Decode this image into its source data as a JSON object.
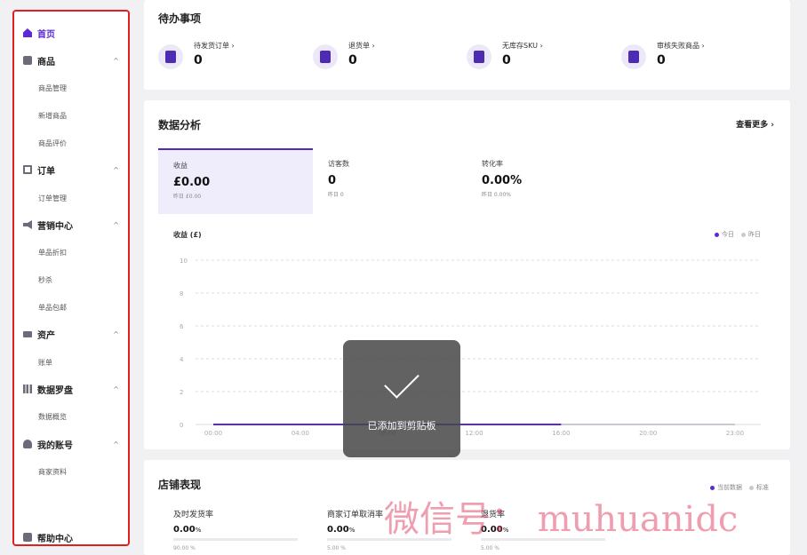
{
  "sidebar": {
    "items": [
      {
        "label": "首页",
        "icon": "home-icon",
        "active": true
      },
      {
        "label": "商品",
        "icon": "box-icon",
        "chevron": "^"
      },
      {
        "label": "商品管理"
      },
      {
        "label": "新增商品"
      },
      {
        "label": "商品评价"
      },
      {
        "label": "订单",
        "icon": "document-icon",
        "chevron": "^"
      },
      {
        "label": "订单管理"
      },
      {
        "label": "营销中心",
        "icon": "megaphone-icon",
        "chevron": "^"
      },
      {
        "label": "单品折扣"
      },
      {
        "label": "秒杀"
      },
      {
        "label": "单品包邮"
      },
      {
        "label": "资产",
        "icon": "card-icon",
        "chevron": "^"
      },
      {
        "label": "账单"
      },
      {
        "label": "数据罗盘",
        "icon": "bar-chart-icon",
        "chevron": "^"
      },
      {
        "label": "数据概览"
      },
      {
        "label": "我的账号",
        "icon": "user-icon",
        "chevron": "^"
      },
      {
        "label": "商家资料"
      },
      {
        "label": "帮助中心",
        "icon": "help-icon"
      }
    ]
  },
  "todo": {
    "title": "待办事项",
    "items": [
      {
        "label": "待发货订单 ›",
        "value": "0",
        "icon": "shipping-doc-icon"
      },
      {
        "label": "退货单 ›",
        "value": "0",
        "icon": "return-doc-icon"
      },
      {
        "label": "无库存SKU ›",
        "value": "0",
        "icon": "stock-icon"
      },
      {
        "label": "审核失败商品 ›",
        "value": "0",
        "icon": "rejected-shield-icon"
      }
    ]
  },
  "analytics": {
    "title": "数据分析",
    "more": "查看更多 ›",
    "metrics": [
      {
        "label": "收益",
        "value": "£0.00",
        "sub": "昨日 £0.00"
      },
      {
        "label": "访客数",
        "value": "0",
        "sub": "昨日 0"
      },
      {
        "label": "转化率",
        "value": "0.00%",
        "sub": "昨日 0.00%"
      }
    ],
    "chart_title": "收益 (£)",
    "legend_today": "今日",
    "legend_yesterday": "昨日"
  },
  "chart_data": {
    "type": "line",
    "x": [
      "00:00",
      "04:00",
      "08:00",
      "12:00",
      "16:00",
      "20:00",
      "23:00"
    ],
    "y_ticks": [
      "10",
      "8",
      "6",
      "4",
      "2",
      "0"
    ],
    "ylim": [
      0,
      10
    ],
    "series": [
      {
        "name": "今日",
        "color": "#5b2ad3",
        "values": [
          0,
          0,
          0,
          0,
          0
        ]
      },
      {
        "name": "昨日",
        "color": "#c9c9d2",
        "values": [
          0,
          0,
          0,
          0,
          0,
          0,
          0
        ]
      }
    ],
    "grid": true,
    "legend_position": "top-right"
  },
  "toast": {
    "text": "已添加到剪贴板"
  },
  "shop": {
    "title": "店铺表现",
    "legend_current": "当前数据",
    "legend_standard": "标准",
    "metrics": [
      {
        "label": "及时发货率",
        "value": "0.00",
        "unit": "%",
        "sub": "90.00 %"
      },
      {
        "label": "商家订单取消率",
        "value": "0.00",
        "unit": "%",
        "sub": "5.00 %"
      },
      {
        "label": "退货率",
        "value": "0.00",
        "unit": "%",
        "sub": "5.00 %"
      }
    ]
  },
  "watermark": "微信号： muhuanidc",
  "colors": {
    "accent": "#5b2ad3",
    "highlight_border": "#e02020"
  }
}
